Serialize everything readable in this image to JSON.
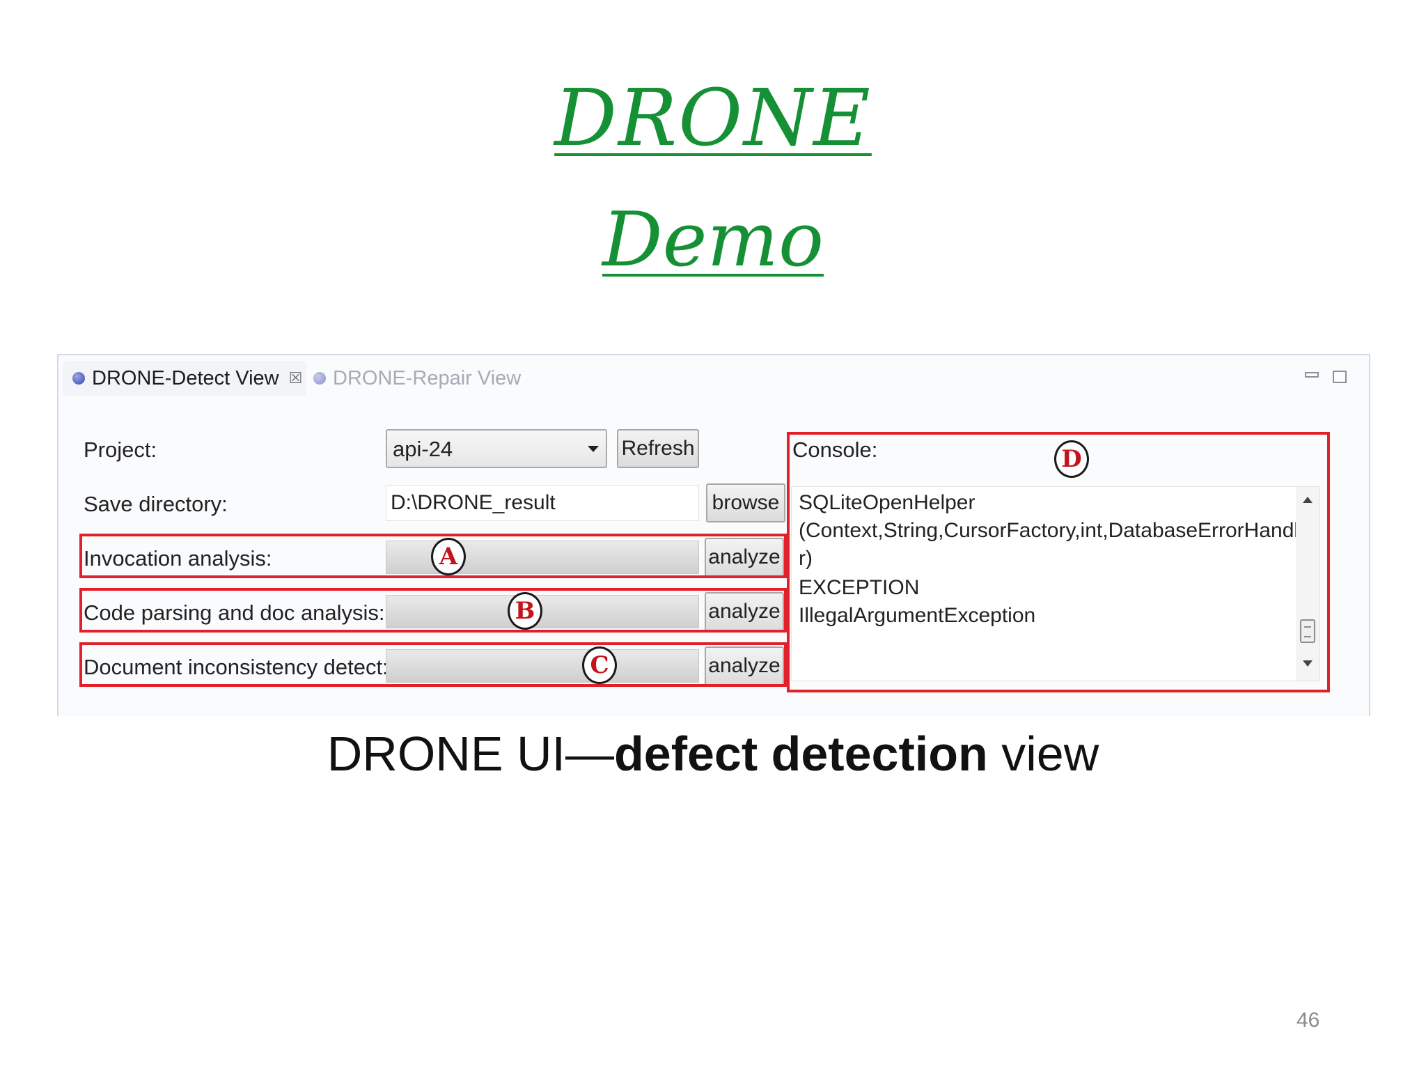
{
  "slide": {
    "title_main": "DRONE",
    "title_sub": "Demo",
    "caption_prefix": "DRONE UI—",
    "caption_bold": "defect detection",
    "caption_suffix": " view",
    "page_number": "46",
    "colors": {
      "title": "#159034",
      "highlight_box": "#e2202a"
    }
  },
  "window": {
    "tabs": [
      {
        "label": "DRONE-Detect View",
        "active": true,
        "close_glyph": "☒"
      },
      {
        "label": "DRONE-Repair View",
        "active": false
      }
    ],
    "controls": [
      "minimize-icon",
      "maximize-icon"
    ]
  },
  "form": {
    "project_label": "Project:",
    "project_value": "api-24",
    "refresh_label": "Refresh",
    "save_dir_label": "Save directory:",
    "save_dir_value": "D:\\DRONE_result",
    "browse_label": "browse",
    "rows": [
      {
        "label": "Invocation analysis:",
        "button": "analyze",
        "marker": "A"
      },
      {
        "label": "Code parsing and doc analysis:",
        "button": "analyze",
        "marker": "B"
      },
      {
        "label": "Document inconsistency detect:",
        "button": "analyze",
        "marker": "C"
      }
    ]
  },
  "console": {
    "label": "Console:",
    "marker": "D",
    "lines": [
      "SQLiteOpenHelper",
      "(Context,String,CursorFactory,int,DatabaseErrorHandle",
      "r)",
      "EXCEPTION",
      "IllegalArgumentException"
    ]
  }
}
